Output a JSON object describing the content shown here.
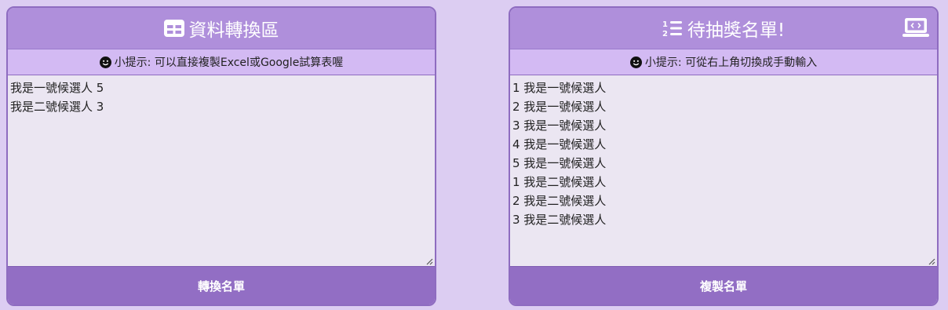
{
  "left_panel": {
    "title": "資料轉換區",
    "title_icon": "table-icon",
    "hint": "小提示: 可以直接複製Excel或Google試算表喔",
    "hint_icon": "smile-icon",
    "textarea_value": "我是一號候選人 5\n我是二號候選人 3",
    "button_label": "轉換名單"
  },
  "right_panel": {
    "title": "待抽獎名單!",
    "title_icon": "numbered-list-icon",
    "switch_icon": "laptop-code-icon",
    "hint": "小提示: 可從右上角切換成手動輸入",
    "hint_icon": "smile-icon",
    "textarea_value": "1 我是一號候選人\n2 我是一號候選人\n3 我是一號候選人\n4 我是一號候選人\n5 我是一號候選人\n1 我是二號候選人\n2 我是二號候選人\n3 我是二號候選人",
    "button_label": "複製名單"
  },
  "colors": {
    "page_bg": "#dccdf2",
    "header_bg": "#af8fdb",
    "hint_bg": "#d3baf3",
    "button_bg": "#926ec4",
    "border": "#8e6cc0"
  }
}
